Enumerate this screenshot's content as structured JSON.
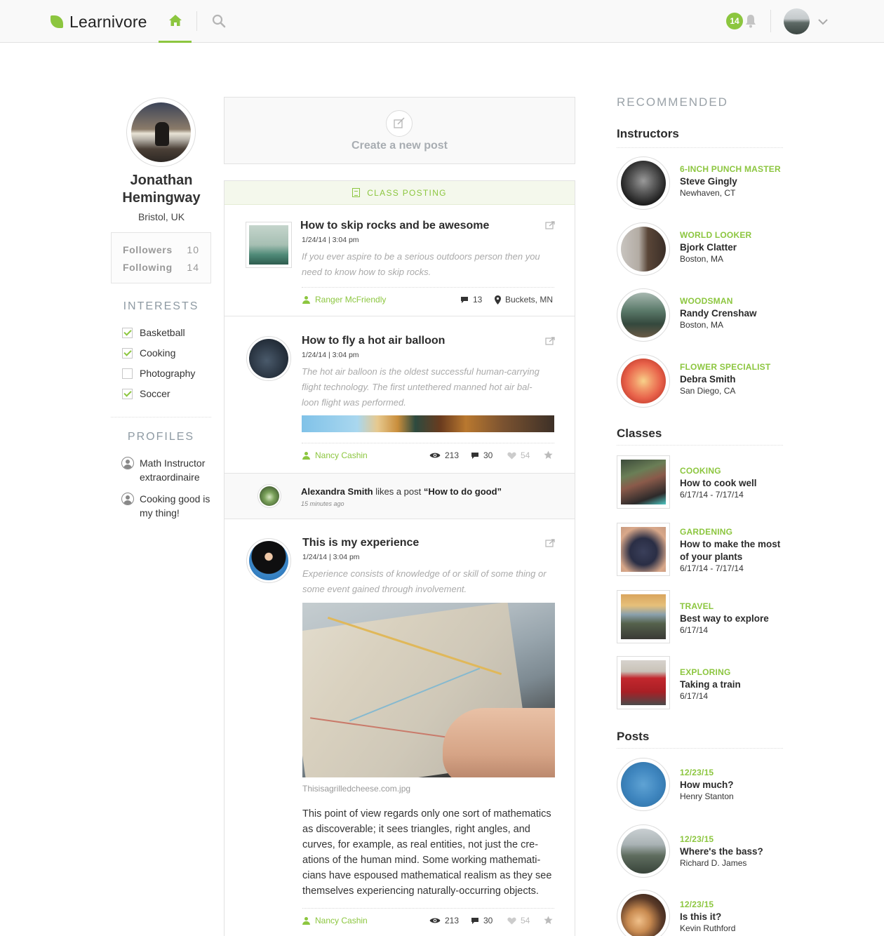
{
  "header": {
    "brand": "Learnivore",
    "notification_count": "14",
    "colors": {
      "accent": "#8cc63f",
      "header_bg": "#f9f9f9"
    }
  },
  "profile": {
    "name": "Jonathan Hemingway",
    "location": "Bristol, UK",
    "followers_label": "Followers",
    "followers_count": "10",
    "following_label": "Following",
    "following_count": "14"
  },
  "interests": {
    "title": "INTERESTS",
    "items": [
      {
        "label": "Basketball",
        "checked": true
      },
      {
        "label": "Cooking",
        "checked": true
      },
      {
        "label": "Photography",
        "checked": false
      },
      {
        "label": "Soccer",
        "checked": true
      }
    ]
  },
  "profiles": {
    "title": "PROFILES",
    "items": [
      {
        "line1": "Math Instructor",
        "line2": "extraordinaire"
      },
      {
        "line1": "Cooking good is",
        "line2": "my thing!"
      }
    ]
  },
  "create_post": {
    "label": "Create a new post"
  },
  "feed": {
    "class_bar": "CLASS POSTING",
    "posts": [
      {
        "title": "How to skip rocks and be awesome",
        "date": "1/24/14  |  3:04 pm",
        "desc1": "If you ever aspire to be a serious outdoors person then you",
        "desc2": "need to know how to skip rocks.",
        "author": "Ranger McFriendly",
        "comments": "13",
        "location": "Buckets, MN"
      },
      {
        "title": "How to fly a hot air balloon",
        "date": "1/24/14  |  3:04 pm",
        "desc1": "The hot air balloon is the oldest successful human-carrying",
        "desc2": "flight technology. The first untethered manned hot air bal-",
        "desc3": "loon flight was performed.",
        "author": "Nancy Cashin",
        "views": "213",
        "comments": "30",
        "likes": "54"
      },
      {
        "title": "This is my experience",
        "date": "1/24/14  |  3:04 pm",
        "desc1": "Experience consists of knowledge of or skill of some thing or",
        "desc2": "some event gained through involvement.",
        "caption": "Thisisagrilledcheese.com.jpg",
        "body": [
          "This point of view regards only one sort of mathematics",
          "as discoverable; it sees triangles, right angles, and",
          "curves, for example, as real entities, not just the cre-",
          "ations of the human mind. Some working mathemati-",
          "cians have espoused mathematical realism as they see",
          "themselves experiencing naturally-occurring objects."
        ],
        "author": "Nancy Cashin",
        "views": "213",
        "comments": "30",
        "likes": "54"
      }
    ],
    "activity": {
      "user": "Alexandra Smith",
      "action": " likes a post ",
      "post": "“How to do good”",
      "time": "15 minutes ago"
    }
  },
  "recommended": {
    "title": "RECOMMENDED",
    "instructors_title": "Instructors",
    "instructors": [
      {
        "tag": "6-INCH PUNCH MASTER",
        "name": "Steve Gingly",
        "place": "Newhaven, CT"
      },
      {
        "tag": "WORLD LOOKER",
        "name": "Bjork Clatter",
        "place": "Boston, MA"
      },
      {
        "tag": "WOODSMAN",
        "name": "Randy Crenshaw",
        "place": "Boston, MA"
      },
      {
        "tag": "FLOWER SPECIALIST",
        "name": "Debra Smith",
        "place": "San Diego, CA"
      }
    ],
    "classes_title": "Classes",
    "classes": [
      {
        "tag": "COOKING",
        "name": "How to cook well",
        "dates": "6/17/14 - 7/17/14"
      },
      {
        "tag": "GARDENING",
        "name": "How to make the most of your plants",
        "dates": "6/17/14 - 7/17/14"
      },
      {
        "tag": "TRAVEL",
        "name": "Best way to explore",
        "dates": "6/17/14"
      },
      {
        "tag": "EXPLORING",
        "name": "Taking a train",
        "dates": "6/17/14"
      }
    ],
    "posts_title": "Posts",
    "posts": [
      {
        "date": "12/23/15",
        "title": "How much?",
        "author": "Henry Stanton"
      },
      {
        "date": "12/23/15",
        "title": "Where's the bass?",
        "author": "Richard D. James"
      },
      {
        "date": "12/23/15",
        "title": "Is this it?",
        "author": "Kevin Ruthford"
      }
    ]
  }
}
